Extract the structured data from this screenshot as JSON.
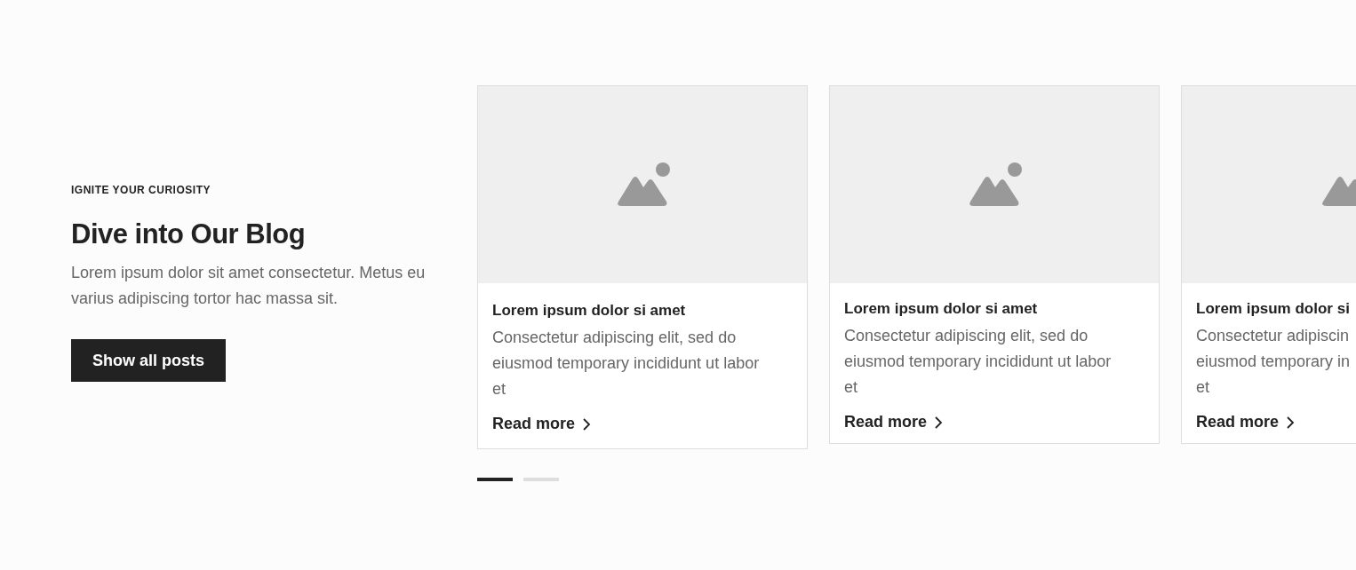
{
  "intro": {
    "eyebrow": "IGNITE YOUR CURIOSITY",
    "title": "Dive into Our Blog",
    "description": "Lorem ipsum dolor sit amet consectetur. Metus eu varius adipiscing tortor hac massa sit.",
    "button": "Show all posts"
  },
  "posts": [
    {
      "kind": "full",
      "title": "Lorem ipsum dolor si amet",
      "body": "Consectetur adipiscing elit, sed do eiusmod temporary incididunt ut labor et",
      "link": "Read more"
    },
    {
      "kind": "full",
      "title": "Lorem ipsum dolor si amet",
      "body": "Consectetur adipiscing elit, sed do eiusmod temporary incididunt ut labor et",
      "link": "Read more"
    },
    {
      "kind": "cut",
      "title": "Lorem ipsum dolor si",
      "body": "Consectetur adipiscin\neiusmod temporary in\net",
      "link": "Read more"
    }
  ],
  "pagination": [
    {
      "selected": true
    },
    {
      "selected": false
    }
  ]
}
